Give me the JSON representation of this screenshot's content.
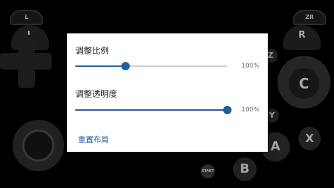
{
  "controller": {
    "left_trigger": "L",
    "right_trigger": "ZR",
    "left_shoulder": "L",
    "right_shoulder": "R",
    "c_button": "C",
    "z_button": "Z",
    "y_button": "Y",
    "a_button": "A",
    "b_button": "B",
    "x_button": "X",
    "start_button": "START"
  },
  "dialog": {
    "scale": {
      "label": "调整比例",
      "value_text": "100%",
      "level": 0.33
    },
    "opacity": {
      "label": "调整透明度",
      "value_text": "100%",
      "level": 1.0
    },
    "reset_label": "重置布局"
  },
  "colors": {
    "accent": "#1f5f9c",
    "background": "#000000",
    "dialog": "#ffffff"
  }
}
